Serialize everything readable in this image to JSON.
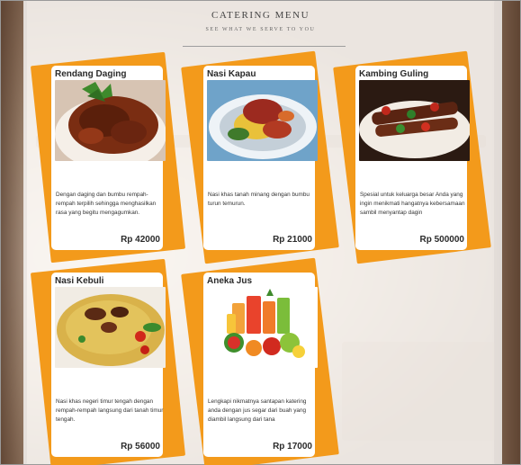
{
  "header": {
    "title": "CATERING MENU",
    "subtitle": "SEE WHAT WE SERVE TO YOU"
  },
  "menu_items": [
    {
      "name": "Rendang Daging",
      "description": "Dengan daging dan bumbu rempah-rempah terpilih sehingga menghasilkan rasa yang begitu mengagumkan.",
      "price": "Rp 42000",
      "image_icon": "beef-rendang-dish-icon"
    },
    {
      "name": "Nasi Kapau",
      "description": "Nasi khas tanah minang dengan bumbu turun temurun.",
      "price": "Rp 21000",
      "image_icon": "nasi-kapau-plate-icon"
    },
    {
      "name": "Kambing Guling",
      "description": "Spesial untuk keluarga besar Anda yang ingin menikmati hangatnya kebersamaan sambil menyantap dagin",
      "price": "Rp 500000",
      "image_icon": "lamb-skewer-plate-icon"
    },
    {
      "name": "Nasi Kebuli",
      "description": "Nasi khas negeri timur tengah dengan rempah-rempah langsung dari tanah timur tengah.",
      "price": "Rp 56000",
      "image_icon": "nasi-kebuli-plate-icon"
    },
    {
      "name": "Aneka Jus",
      "description": "Lengkapi nikmatnya santapan katering anda dengan jus segar dari buah yang diambil langsung dari tana",
      "price": "Rp 17000",
      "image_icon": "fruit-juice-glasses-icon"
    }
  ],
  "colors": {
    "accent_orange": "#f39a1b",
    "card_background": "#ffffff",
    "panel_overlay": "#ffffff"
  }
}
